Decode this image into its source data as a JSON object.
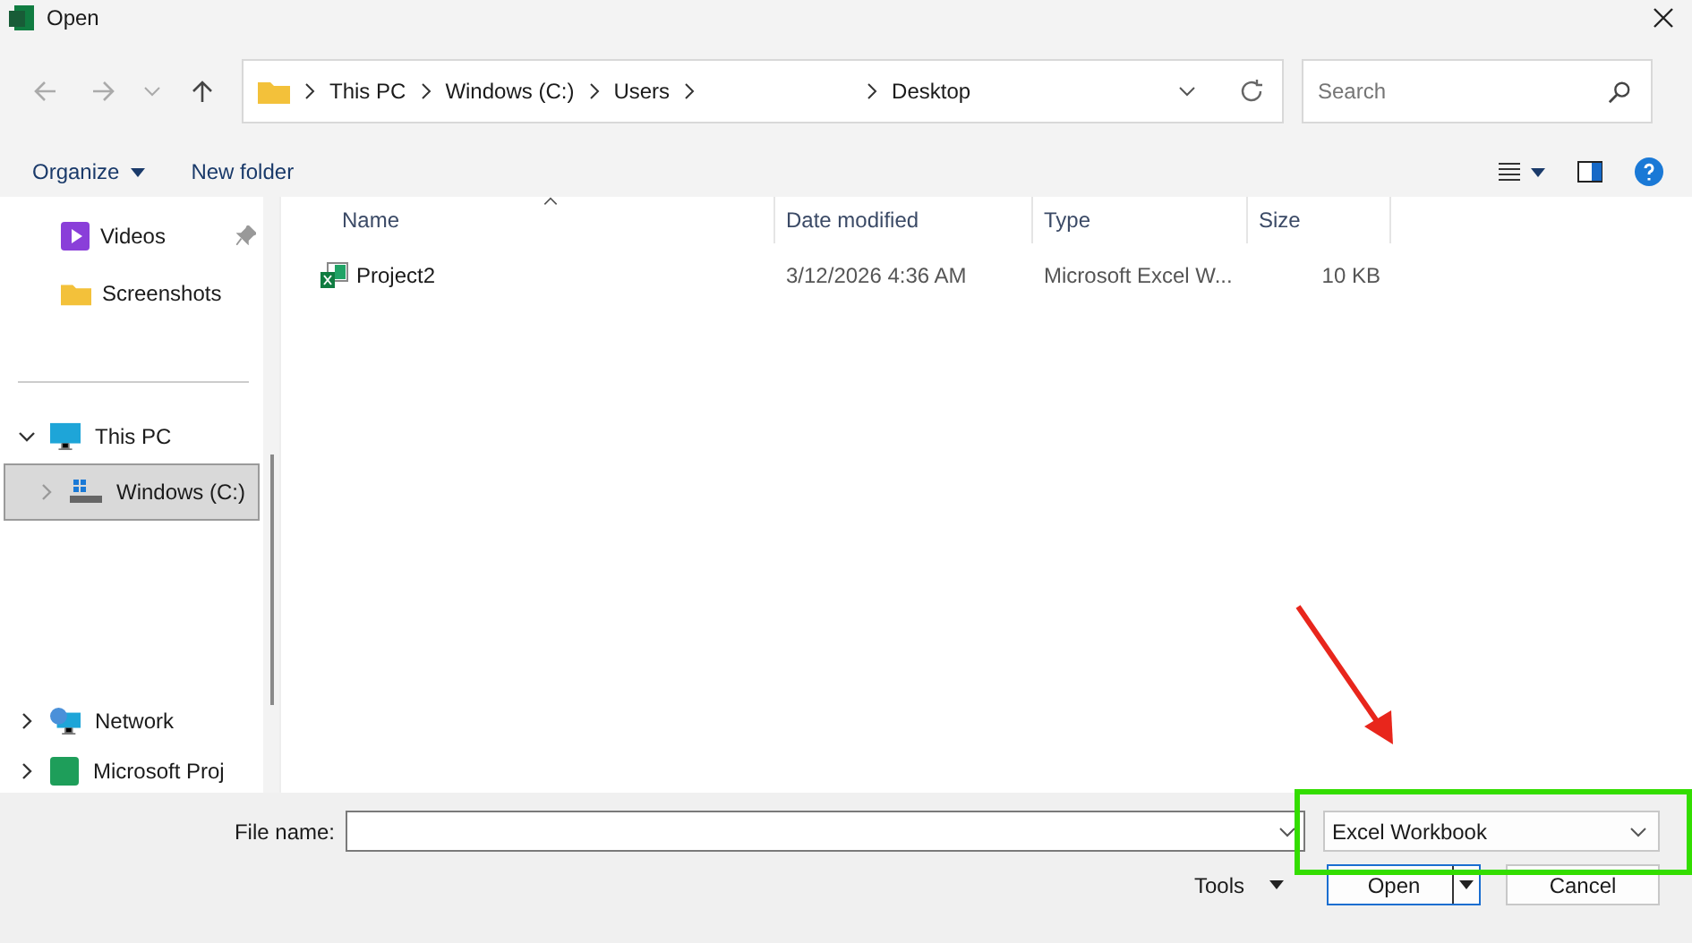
{
  "window": {
    "title": "Open"
  },
  "address_bar": {
    "segments": [
      {
        "label": "This PC",
        "kind": "folder"
      },
      {
        "label": "Windows (C:)",
        "kind": "folder"
      },
      {
        "label": "Users",
        "kind": "folder"
      },
      {
        "kind": "blank"
      },
      {
        "label": "Desktop",
        "kind": "folder"
      }
    ]
  },
  "search": {
    "placeholder": "Search"
  },
  "toolbar": {
    "organize": "Organize",
    "new_folder": "New folder"
  },
  "nav": {
    "quick_access": [
      {
        "label": "Videos",
        "kind": "videos",
        "pinned": true
      },
      {
        "label": "Screenshots",
        "kind": "folder",
        "pinned": false
      }
    ],
    "tree": [
      {
        "label": "This PC",
        "kind": "pc",
        "expanded": true,
        "children": [
          {
            "label": "Windows (C:)",
            "kind": "drive",
            "expanded": false,
            "selected": true
          }
        ]
      },
      {
        "label": "Network",
        "kind": "network",
        "expanded": false
      },
      {
        "label": "Microsoft Proj",
        "kind": "app",
        "expanded": false
      }
    ]
  },
  "table": {
    "columns": [
      {
        "label": "Name",
        "sorted": true
      },
      {
        "label": "Date modified",
        "sorted": false
      },
      {
        "label": "Type",
        "sorted": false
      },
      {
        "label": "Size",
        "sorted": false
      }
    ],
    "rows": [
      {
        "name": "Project2",
        "date": "3/12/2026 4:36 AM",
        "type": "Microsoft Excel W...",
        "size": "10 KB"
      }
    ]
  },
  "footer": {
    "file_name_label": "File name:",
    "file_type": "Excel Workbook",
    "tools": "Tools",
    "open": "Open",
    "cancel": "Cancel"
  }
}
